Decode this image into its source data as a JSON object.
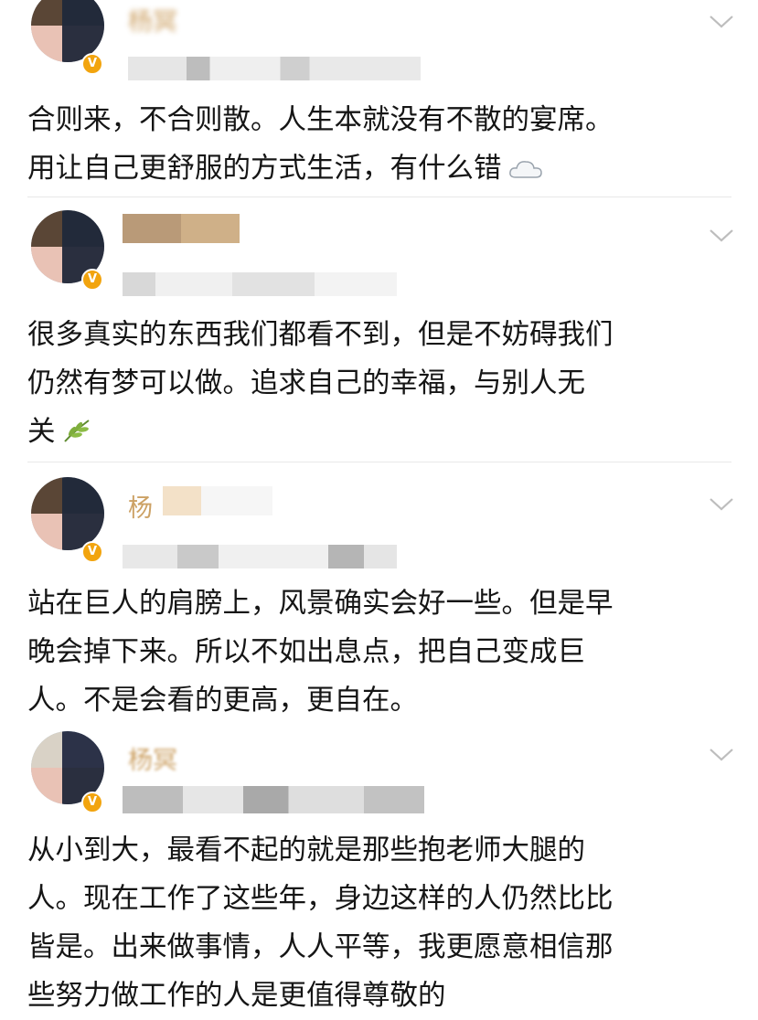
{
  "comments": [
    {
      "name": "杨冥",
      "lines": [
        "合则来，不合则散。人生本就没有不散的宴席。",
        "用让自己更舒服的方式生活，有什么错"
      ],
      "emoji": "cloud-icon"
    },
    {
      "name": "",
      "lines": [
        "很多真实的东西我们都看不到，但是不妨碍我们",
        "仍然有梦可以做。追求自己的幸福，与别人无",
        "关"
      ],
      "emoji": "leaf-icon"
    },
    {
      "name": "杨",
      "lines": [
        "站在巨人的肩膀上，风景确实会好一些。但是早",
        "晚会掉下来。所以不如出息点，把自己变成巨",
        "人。不是会看的更高，更自在。"
      ]
    },
    {
      "name": "杨冥",
      "lines": [
        "从小到大，最看不起的就是那些抱老师大腿的",
        "人。现在工作了这些年，身边这样的人仍然比比",
        "皆是。出来做事情，人人平等，我更愿意相信那",
        "些努力做工作的人是更值得尊敬的"
      ]
    }
  ],
  "colors": {
    "accent": "#f2a40e",
    "name": "#c08a3e",
    "text": "#151515"
  }
}
